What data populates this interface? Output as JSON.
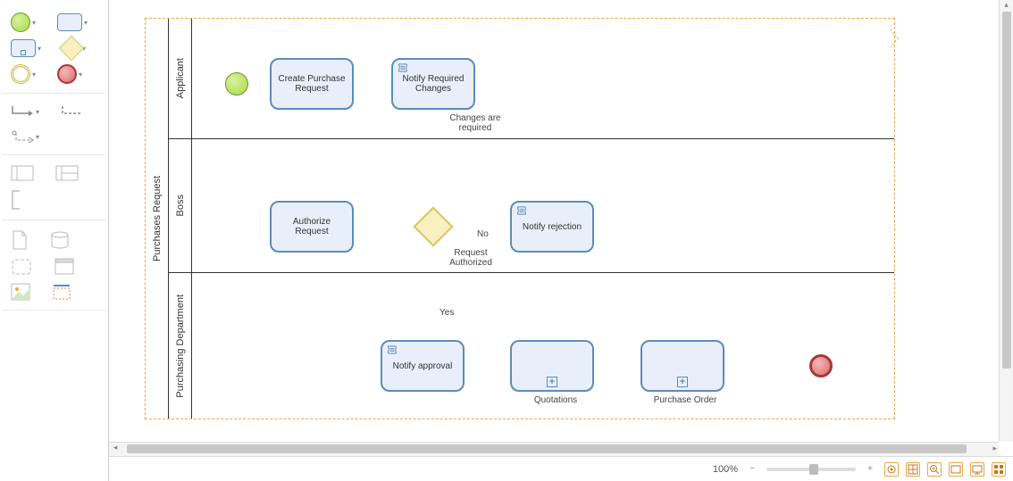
{
  "palette": {
    "tooltip_start": "Start Event",
    "tooltip_task": "Task",
    "tooltip_sub": "Subprocess",
    "tooltip_gateway": "Gateway",
    "tooltip_intermediate": "Intermediate Event",
    "tooltip_end": "End Event"
  },
  "diagram": {
    "pool_title": "Purchases Request",
    "lanes": [
      {
        "title": "Applicant"
      },
      {
        "title": "Boss"
      },
      {
        "title": "Purchasing Department"
      }
    ],
    "nodes": {
      "start": {
        "type": "start-event"
      },
      "create_purchase_request": {
        "label": "Create Purchase Request",
        "type": "task"
      },
      "notify_required_changes": {
        "label": "Notify Required Changes",
        "type": "script-task"
      },
      "authorize_request": {
        "label": "Authorize Request",
        "type": "task"
      },
      "gateway_auth": {
        "type": "exclusive-gateway"
      },
      "notify_rejection": {
        "label": "Notify rejection",
        "type": "script-task"
      },
      "notify_approval": {
        "label": "Notify approval",
        "type": "script-task"
      },
      "quotations": {
        "label": "Quotations",
        "type": "subprocess"
      },
      "purchase_order": {
        "label": "Purchase Order",
        "type": "subprocess"
      },
      "end": {
        "type": "end-event"
      }
    },
    "edge_labels": {
      "changes_required": "Changes are required",
      "request_authorized": "Request Authorized",
      "no": "No",
      "yes": "Yes"
    }
  },
  "statusbar": {
    "zoom_pct": "100%",
    "minus": "−",
    "plus": "+"
  },
  "chart_data": {
    "type": "bpmn-diagram",
    "pool": "Purchases Request",
    "lanes": [
      "Applicant",
      "Boss",
      "Purchasing Department"
    ],
    "nodes": [
      {
        "id": "start",
        "type": "startEvent",
        "lane": "Applicant"
      },
      {
        "id": "create",
        "type": "task",
        "label": "Create Purchase Request",
        "lane": "Applicant"
      },
      {
        "id": "notify_changes",
        "type": "scriptTask",
        "label": "Notify Required Changes",
        "lane": "Applicant"
      },
      {
        "id": "authorize",
        "type": "task",
        "label": "Authorize Request",
        "lane": "Boss"
      },
      {
        "id": "gw",
        "type": "exclusiveGateway",
        "lane": "Boss"
      },
      {
        "id": "notify_reject",
        "type": "scriptTask",
        "label": "Notify rejection",
        "lane": "Boss"
      },
      {
        "id": "notify_approve",
        "type": "scriptTask",
        "label": "Notify approval",
        "lane": "Purchasing Department"
      },
      {
        "id": "quotations",
        "type": "subProcess",
        "label": "Quotations",
        "lane": "Purchasing Department"
      },
      {
        "id": "purchase_order",
        "type": "subProcess",
        "label": "Purchase Order",
        "lane": "Purchasing Department"
      },
      {
        "id": "end",
        "type": "endEvent",
        "lane": "Purchasing Department"
      }
    ],
    "edges": [
      {
        "from": "start",
        "to": "create"
      },
      {
        "from": "create",
        "to": "authorize"
      },
      {
        "from": "authorize",
        "to": "gw"
      },
      {
        "from": "gw",
        "to": "notify_changes",
        "label": "Changes are required"
      },
      {
        "from": "notify_changes",
        "to": "create"
      },
      {
        "from": "gw",
        "to": "notify_reject",
        "label": "No"
      },
      {
        "from": "gw",
        "to": "notify_approve",
        "label": "Yes",
        "condition_sublabel": "Request Authorized"
      },
      {
        "from": "notify_approve",
        "to": "quotations"
      },
      {
        "from": "quotations",
        "to": "purchase_order"
      },
      {
        "from": "purchase_order",
        "to": "end"
      },
      {
        "from": "notify_reject",
        "to": "end"
      }
    ]
  }
}
